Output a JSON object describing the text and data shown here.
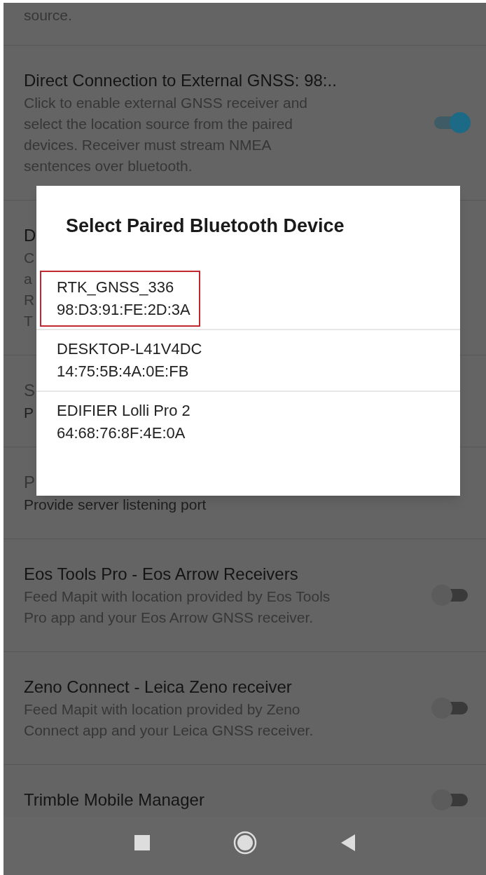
{
  "settings": [
    {
      "kind": "continuation",
      "lines": [
        "source."
      ],
      "disabled": false
    },
    {
      "kind": "toggle",
      "title": "Direct Connection to External GNSS: 98:..",
      "lines": [
        "Click to enable external GNSS receiver and",
        "select the location source from the paired",
        "devices. Receiver must stream NMEA",
        "sentences over bluetooth."
      ],
      "disabled": false,
      "on": true
    },
    {
      "kind": "plain",
      "title": "D",
      "lines": [
        "C",
        "a",
        "R",
        "T"
      ],
      "disabled": false
    },
    {
      "kind": "plain",
      "title": "S",
      "lines": [
        "P"
      ],
      "disabled": true
    },
    {
      "kind": "plain",
      "title": "P",
      "lines": [
        "Provide server listening port"
      ],
      "disabled": true
    },
    {
      "kind": "toggle",
      "title": "Eos Tools Pro - Eos Arrow Receivers",
      "lines": [
        "Feed Mapit with location provided by Eos Tools",
        "Pro app and your Eos Arrow GNSS receiver."
      ],
      "disabled": false,
      "on": false
    },
    {
      "kind": "toggle",
      "title": "Zeno Connect - Leica Zeno receiver",
      "lines": [
        "Feed Mapit with location provided by Zeno",
        "Connect app and your Leica GNSS receiver."
      ],
      "disabled": false,
      "on": false
    },
    {
      "kind": "toggle",
      "title": "Trimble Mobile Manager",
      "disabled": false,
      "on": false
    }
  ],
  "dialog": {
    "title": "Select Paired Bluetooth Device",
    "devices": [
      {
        "name": "RTK_GNSS_336",
        "address": "98:D3:91:FE:2D:3A",
        "highlighted": true
      },
      {
        "name": "DESKTOP-L41V4DC",
        "address": "14:75:5B:4A:0E:FB",
        "highlighted": false
      },
      {
        "name": "EDIFIER Lolli Pro 2",
        "address": "64:68:76:8F:4E:0A",
        "highlighted": false
      }
    ]
  }
}
